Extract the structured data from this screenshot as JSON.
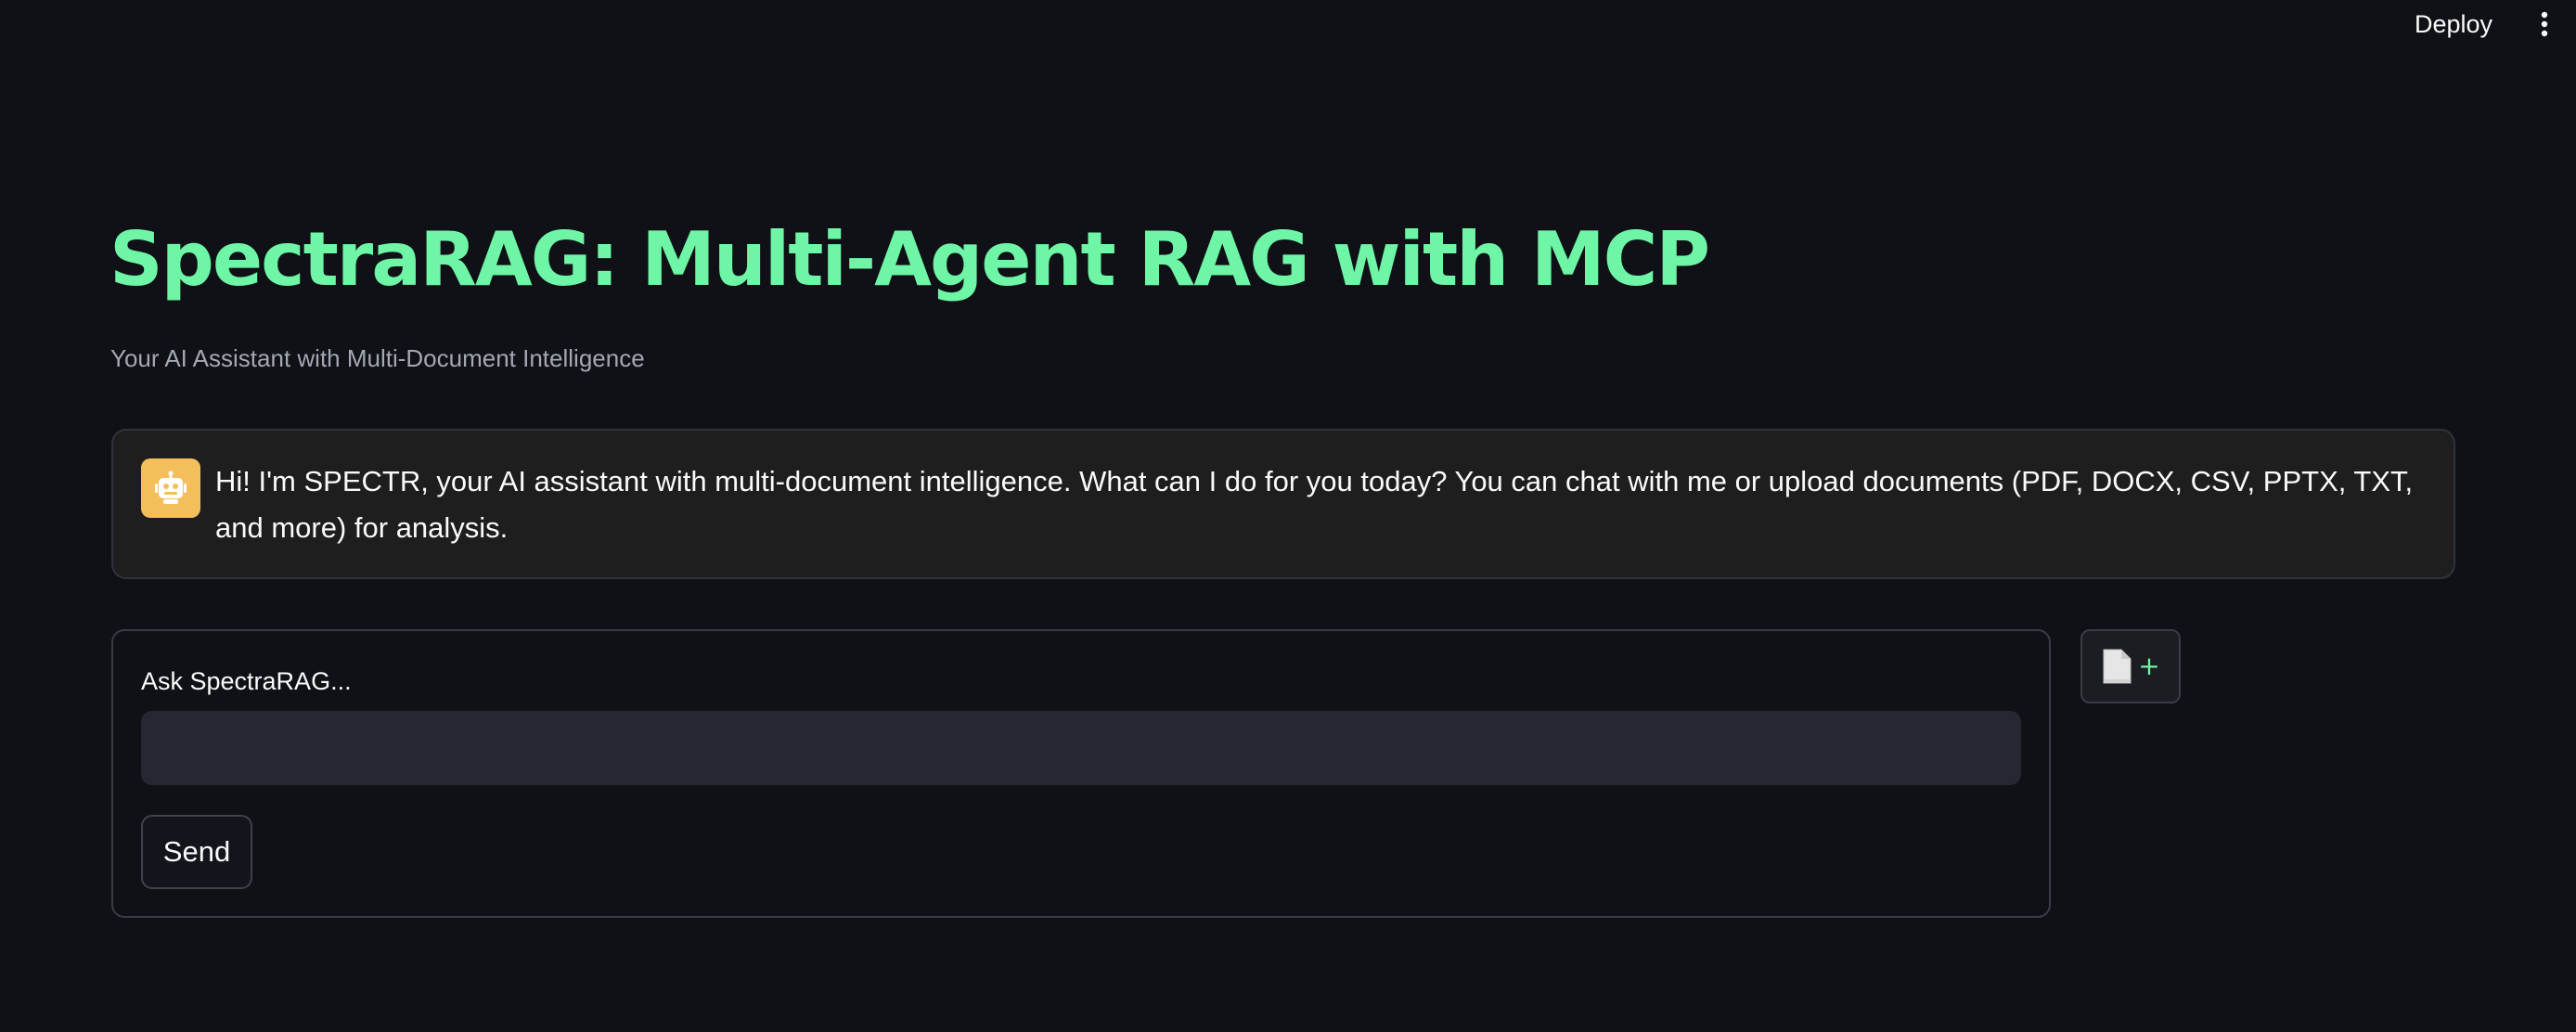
{
  "header": {
    "deploy_label": "Deploy",
    "menu_icon": "vertical-ellipsis-icon"
  },
  "page": {
    "title": "SpectraRAG: Multi-Agent RAG with MCP",
    "subtitle": "Your AI Assistant with Multi-Document Intelligence",
    "title_color": "#6ef5a6"
  },
  "chat": {
    "assistant_avatar_icon": "robot-icon",
    "assistant_avatar_color": "#f4bf5b",
    "messages": [
      {
        "role": "assistant",
        "text": "Hi! I'm SPECTR, your AI assistant with multi-document intelligence. What can I do for you today? You can chat with me or upload documents (PDF, DOCX, CSV, PPTX, TXT, and more) for analysis."
      }
    ]
  },
  "form": {
    "input_label": "Ask SpectraRAG...",
    "input_value": "",
    "send_label": "Send"
  },
  "upload": {
    "icon": "document-icon",
    "plus": "+"
  }
}
